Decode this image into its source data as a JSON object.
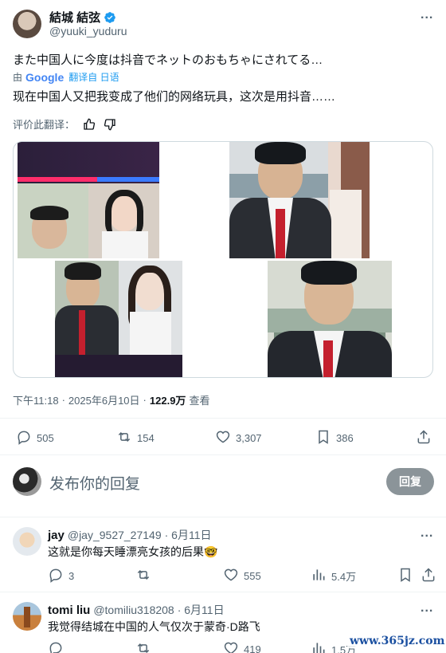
{
  "author": {
    "display_name": "結城 結弦",
    "handle": "@yuuki_yuduru",
    "verified": true
  },
  "more_label": "...",
  "tweet": {
    "text_original": "また中国人に今度は抖音でネットのおもちゃにされてる…",
    "translated_by_prefix": "由",
    "google_label": "Google",
    "translated_from": "翻译自 日语",
    "text_translated": "现在中国人又把我变成了他们的网络玩具，这次是用抖音……",
    "rate_translation": "评价此翻译："
  },
  "meta": {
    "time": "下午11:18",
    "dot": "·",
    "date": "2025年6月10日",
    "views": "122.9万",
    "views_label": "查看"
  },
  "actions": {
    "replies": "505",
    "retweets": "154",
    "likes": "3,307",
    "bookmarks": "386"
  },
  "compose": {
    "placeholder": "发布你的回复",
    "reply_button": "回复"
  },
  "replies": [
    {
      "name": "jay",
      "handle": "@jay_9527_27149",
      "date": "· 6月11日",
      "text": "这就是你每天睡漂亮女孩的后果🤓",
      "replies": "3",
      "retweets": "",
      "likes": "555",
      "views": "5.4万"
    },
    {
      "name": "tomi liu",
      "handle": "@tomiliu318208",
      "date": "· 6月11日",
      "text": "我觉得结城在中国的人气仅次于蒙奇·D路飞",
      "replies": "",
      "retweets": "",
      "likes": "419",
      "views": "1.5万"
    }
  ],
  "watermark": "www.365jz.com",
  "colors": {
    "verified": "#1d9bf0",
    "text": "#0f1419",
    "muted": "#536471",
    "reply_button_bg": "#8b9499"
  }
}
